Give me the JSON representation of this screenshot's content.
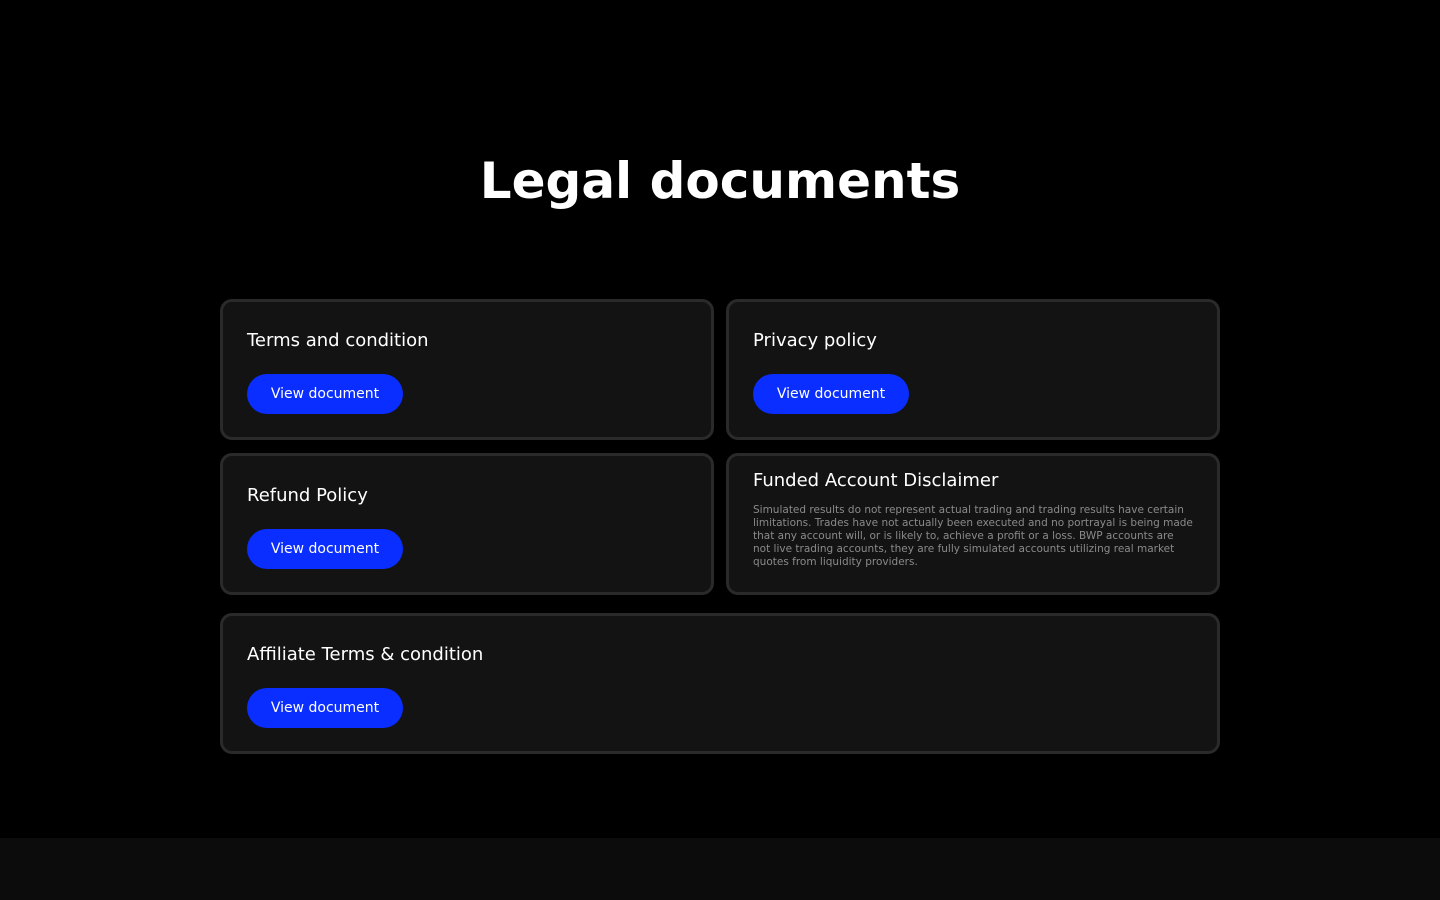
{
  "page": {
    "title": "Legal documents"
  },
  "colors": {
    "background": "#000000",
    "card_background": "#131313",
    "card_border": "#2a2a2a",
    "button_accent": "#0a2eff",
    "body_text_muted": "#8a8a8a"
  },
  "cards": [
    {
      "title": "Terms and condition",
      "button_label": "View document"
    },
    {
      "title": "Privacy policy",
      "button_label": "View document"
    },
    {
      "title": "Refund Policy",
      "button_label": "View document"
    },
    {
      "title": "Funded Account Disclaimer",
      "body": "Simulated results do not represent actual trading and trading results have certain limitations. Trades have not actually been executed and no portrayal is being made that any account will, or is likely to, achieve a profit or a loss. BWP accounts are not live trading accounts, they are fully simulated accounts utilizing real market quotes from liquidity providers."
    },
    {
      "title": "Affiliate Terms & condition",
      "button_label": "View document"
    }
  ]
}
